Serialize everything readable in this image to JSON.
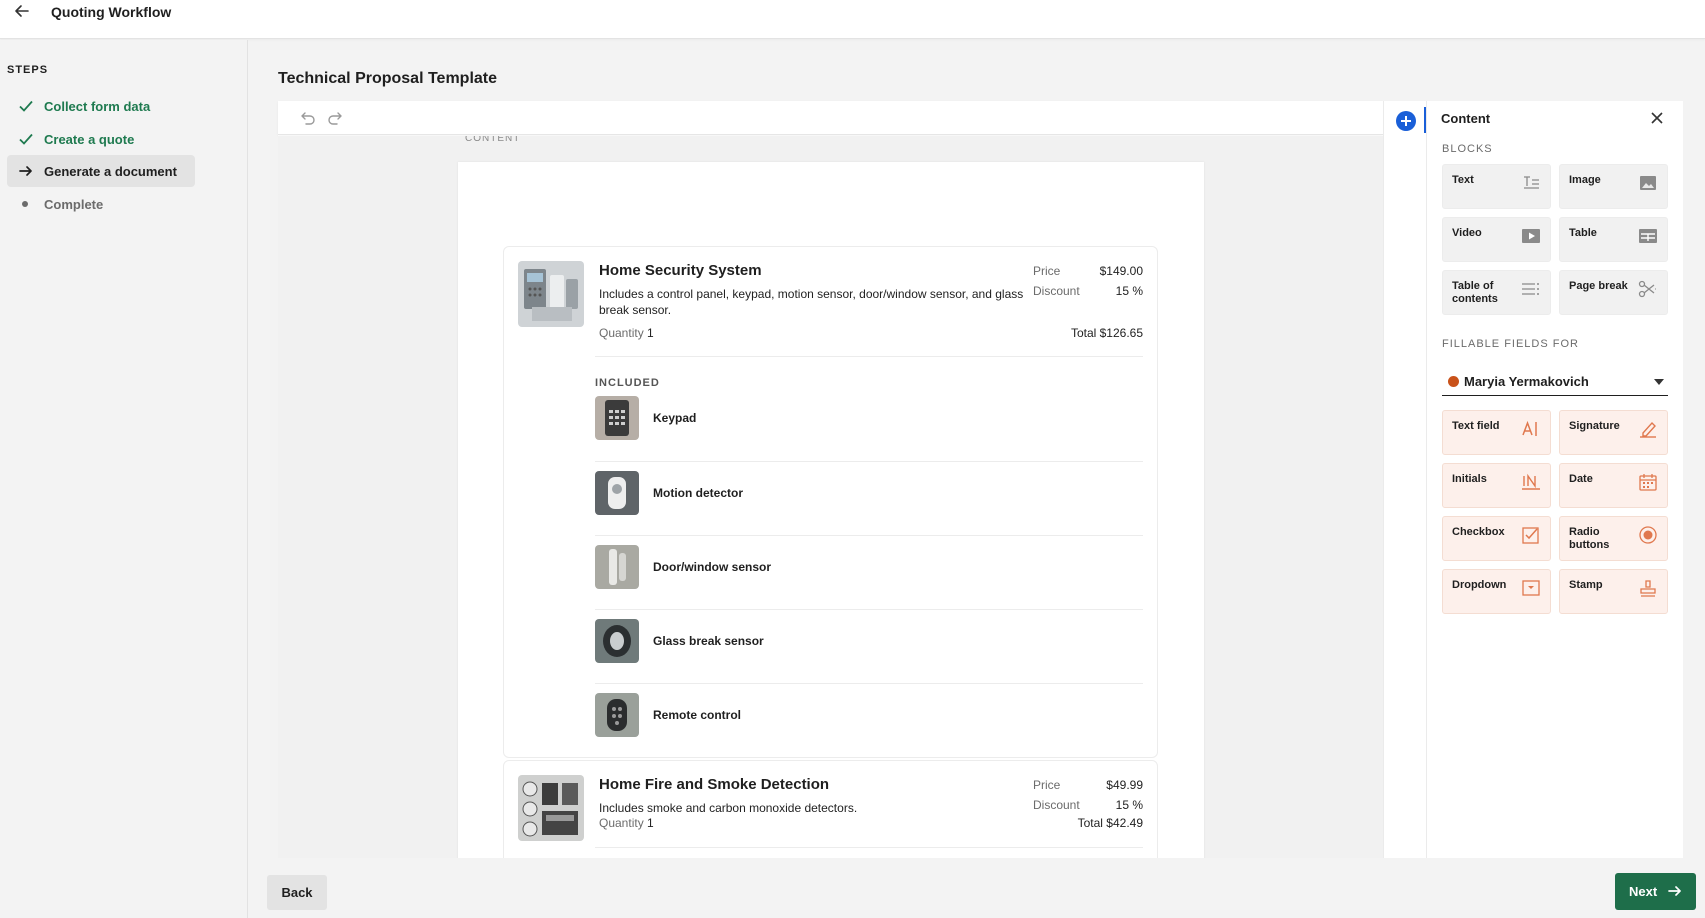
{
  "header": {
    "title": "Quoting Workflow"
  },
  "sidebar": {
    "heading": "STEPS",
    "steps": [
      {
        "label": "Collect form data",
        "state": "done"
      },
      {
        "label": "Create a quote",
        "state": "done"
      },
      {
        "label": "Generate a document",
        "state": "active"
      },
      {
        "label": "Complete",
        "state": "pending"
      }
    ]
  },
  "main": {
    "title": "Technical Proposal Template",
    "canvas_label": "CONTENT",
    "products": [
      {
        "name": "Home Security System",
        "description": "Includes a control panel, keypad, motion sensor, door/window sensor, and glass break sensor.",
        "price_label": "Price",
        "price": "$149.00",
        "discount_label": "Discount",
        "discount": "15 %",
        "quantity_label": "Quantity",
        "quantity": "1",
        "total": "Total $126.65",
        "included_label": "INCLUDED",
        "included": [
          {
            "name": "Keypad"
          },
          {
            "name": "Motion detector"
          },
          {
            "name": "Door/window sensor"
          },
          {
            "name": "Glass break sensor"
          },
          {
            "name": "Remote control"
          }
        ]
      },
      {
        "name": "Home Fire and Smoke Detection",
        "description": "Includes smoke and carbon monoxide detectors.",
        "price_label": "Price",
        "price": "$49.99",
        "discount_label": "Discount",
        "discount": "15 %",
        "quantity_label": "Quantity",
        "quantity": "1",
        "total": "Total $42.49"
      }
    ]
  },
  "panel": {
    "title": "Content",
    "blocks_label": "BLOCKS",
    "blocks": [
      {
        "label": "Text",
        "icon": "text-block-icon"
      },
      {
        "label": "Image",
        "icon": "image-icon"
      },
      {
        "label": "Video",
        "icon": "video-icon"
      },
      {
        "label": "Table",
        "icon": "table-icon"
      },
      {
        "label": "Table of contents",
        "icon": "toc-icon"
      },
      {
        "label": "Page break",
        "icon": "scissors-icon"
      }
    ],
    "fields_label": "FILLABLE FIELDS FOR",
    "signer": {
      "name": "Maryia Yermakovich",
      "color": "#c9521a"
    },
    "fields": [
      {
        "label": "Text field",
        "icon": "text-field-icon"
      },
      {
        "label": "Signature",
        "icon": "pen-icon"
      },
      {
        "label": "Initials",
        "icon": "initials-icon"
      },
      {
        "label": "Date",
        "icon": "calendar-icon"
      },
      {
        "label": "Checkbox",
        "icon": "checkbox-icon"
      },
      {
        "label": "Radio buttons",
        "icon": "radio-icon"
      },
      {
        "label": "Dropdown",
        "icon": "dropdown-icon"
      },
      {
        "label": "Stamp",
        "icon": "stamp-icon"
      }
    ]
  },
  "footer": {
    "back_label": "Back",
    "next_label": "Next"
  },
  "colors": {
    "accent_green": "#1e6e4a",
    "done_green": "#1e7a4f",
    "field_orange": "#e0784e",
    "plus_blue": "#1a5fd8"
  }
}
